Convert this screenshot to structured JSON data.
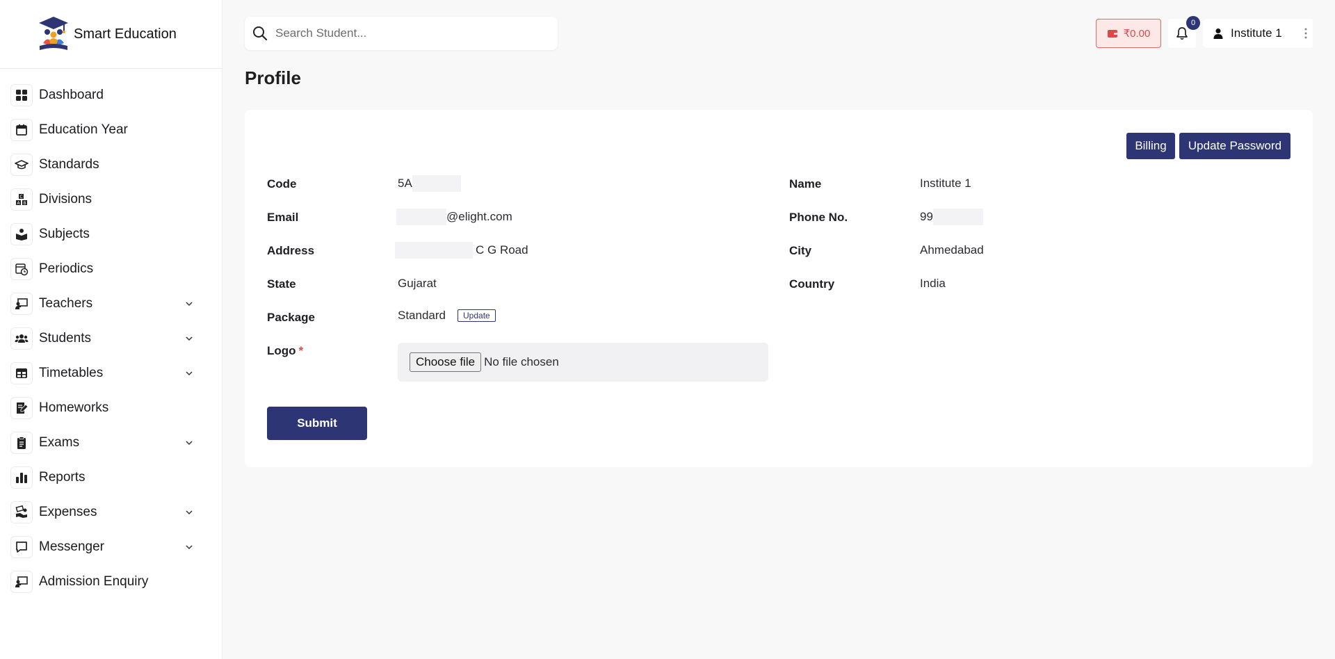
{
  "brand": {
    "name": "Smart Education"
  },
  "sidebar": {
    "items": [
      {
        "label": "Dashboard",
        "icon": "dashboard-icon",
        "expandable": false
      },
      {
        "label": "Education Year",
        "icon": "calendar-icon",
        "expandable": false
      },
      {
        "label": "Standards",
        "icon": "graduation-cap-icon",
        "expandable": false
      },
      {
        "label": "Divisions",
        "icon": "abc-blocks-icon",
        "expandable": false
      },
      {
        "label": "Subjects",
        "icon": "reader-icon",
        "expandable": false
      },
      {
        "label": "Periodics",
        "icon": "calendar-clock-icon",
        "expandable": false
      },
      {
        "label": "Teachers",
        "icon": "chalkboard-teacher-icon",
        "expandable": true
      },
      {
        "label": "Students",
        "icon": "users-icon",
        "expandable": true
      },
      {
        "label": "Timetables",
        "icon": "table-icon",
        "expandable": true
      },
      {
        "label": "Homeworks",
        "icon": "notebook-pen-icon",
        "expandable": false
      },
      {
        "label": "Exams",
        "icon": "clipboard-icon",
        "expandable": true
      },
      {
        "label": "Reports",
        "icon": "bar-chart-icon",
        "expandable": false
      },
      {
        "label": "Expenses",
        "icon": "money-hand-icon",
        "expandable": true
      },
      {
        "label": "Messenger",
        "icon": "message-square-icon",
        "expandable": true
      },
      {
        "label": "Admission Enquiry",
        "icon": "chalkboard-teacher-icon",
        "expandable": false
      }
    ]
  },
  "topbar": {
    "search_placeholder": "Search Student...",
    "wallet_amount": "₹0.00",
    "notification_count": "0",
    "user_name": "Institute 1"
  },
  "page": {
    "title": "Profile"
  },
  "profile": {
    "billing_label": "Billing",
    "update_password_label": "Update Password",
    "fields": {
      "code_label": "Code",
      "code_value": "5A",
      "name_label": "Name",
      "name_value": "Institute 1",
      "email_label": "Email",
      "email_value": "@elight.com",
      "phone_label": "Phone No.",
      "phone_value": "99",
      "address_label": "Address",
      "address_value": "C G Road",
      "city_label": "City",
      "city_value": "Ahmedabad",
      "state_label": "State",
      "state_value": "Gujarat",
      "country_label": "Country",
      "country_value": "India",
      "package_label": "Package",
      "package_value": "Standard",
      "package_update_label": "Update",
      "logo_label": "Logo",
      "logo_required_mark": "*",
      "file_button_label": "Choose file",
      "file_status": "No file chosen"
    },
    "submit_label": "Submit"
  },
  "colors": {
    "primary": "#2e3575",
    "danger": "#e04848",
    "wallet_bg": "#fde8e8"
  }
}
